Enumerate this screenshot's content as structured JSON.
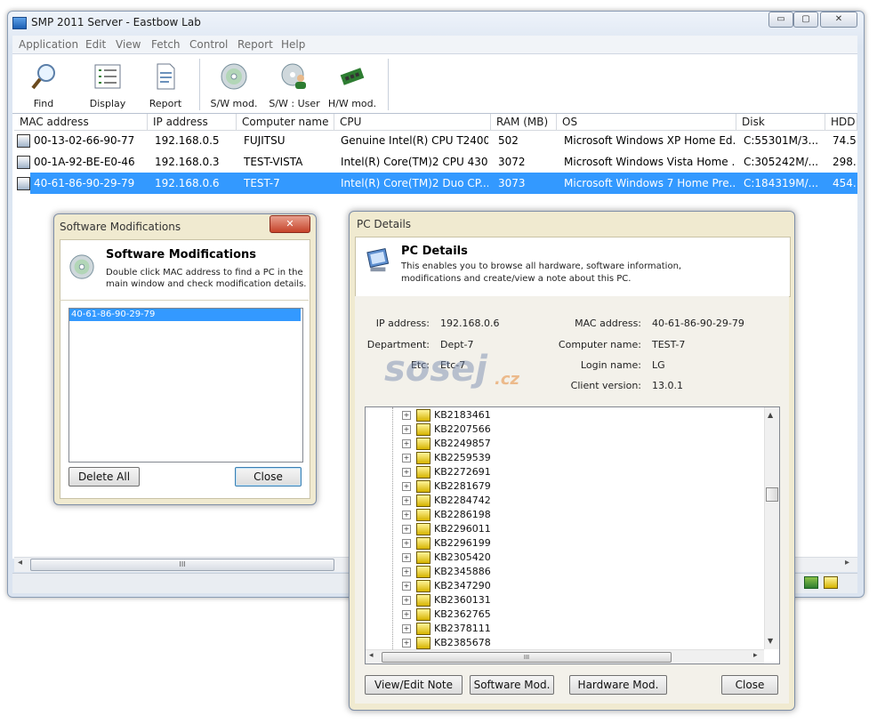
{
  "main_window": {
    "title": "SMP 2011 Server - Eastbow Lab",
    "caption_buttons": {
      "minimize": "▭",
      "maximize": "▢",
      "close": "✕"
    }
  },
  "menu": [
    "Application",
    "Edit",
    "View",
    "Fetch",
    "Control",
    "Report",
    "Help"
  ],
  "toolbar": [
    {
      "label": "Find",
      "icon": "magnifier-icon"
    },
    {
      "label": "Display",
      "icon": "list-icon"
    },
    {
      "label": "Report",
      "icon": "report-icon"
    },
    {
      "label": "S/W mod.",
      "icon": "cd-icon"
    },
    {
      "label": "S/W : User",
      "icon": "cd-user-icon"
    },
    {
      "label": "H/W mod.",
      "icon": "chip-icon"
    }
  ],
  "table": {
    "columns": [
      "MAC address",
      "IP address",
      "Computer name",
      "CPU",
      "RAM (MB)",
      "OS",
      "Disk",
      "HDD"
    ],
    "rows": [
      [
        "00-13-02-66-90-77",
        "192.168.0.5",
        "FUJITSU",
        "Genuine Intel(R) CPU T2400...",
        "502",
        "Microsoft Windows XP Home Ed...",
        "C:55301M/3...",
        "74.5"
      ],
      [
        "00-1A-92-BE-E0-46",
        "192.168.0.3",
        "TEST-VISTA",
        "Intel(R) Core(TM)2 CPU 430...",
        "3072",
        "Microsoft Windows Vista Home ...",
        "C:305242M/...",
        "298."
      ],
      [
        "40-61-86-90-29-79",
        "192.168.0.6",
        "TEST-7",
        "Intel(R) Core(TM)2 Duo CP...",
        "3073",
        "Microsoft Windows 7 Home Pre...",
        "C:184319M/...",
        "454."
      ]
    ],
    "selected_row": 2
  },
  "hscroll": {
    "grip": "III",
    "left": "◂",
    "right": "▸"
  },
  "sw_dialog": {
    "title": "Software Modifications",
    "close": "✕",
    "heading": "Software Modifications",
    "description_line1": "Double click MAC address to find a PC in the",
    "description_line2": "main window and check modification details.",
    "list_items": [
      "40-61-86-90-29-79"
    ],
    "delete_all": "Delete All",
    "close_button": "Close"
  },
  "pc_dialog": {
    "title": "PC Details",
    "heading": "PC Details",
    "description_line1": "This enables you to browse all hardware, software information,",
    "description_line2": "modifications and create/view a note about this PC.",
    "fields": {
      "ip_label": "IP address:",
      "ip_value": "192.168.0.6",
      "dept_label": "Department:",
      "dept_value": "Dept-7",
      "etc_label": "Etc:",
      "etc_value": "Etc-7",
      "mac_label": "MAC address:",
      "mac_value": "40-61-86-90-29-79",
      "name_label": "Computer name:",
      "name_value": "TEST-7",
      "login_label": "Login name:",
      "login_value": "LG",
      "client_label": "Client version:",
      "client_value": "13.0.1"
    },
    "tree_items": [
      "KB2183461",
      "KB2207566",
      "KB2249857",
      "KB2259539",
      "KB2272691",
      "KB2281679",
      "KB2284742",
      "KB2286198",
      "KB2296011",
      "KB2296199",
      "KB2305420",
      "KB2345886",
      "KB2347290",
      "KB2360131",
      "KB2362765",
      "KB2378111",
      "KB2385678"
    ],
    "buttons": {
      "note": "View/Edit Note",
      "sw": "Software Mod.",
      "hw": "Hardware Mod.",
      "close": "Close"
    },
    "hscroll_grip": "III"
  },
  "watermark": {
    "text": "sosej",
    "suffix": ".cz"
  },
  "colors": {
    "selection": "#3399ff",
    "dialog_bg": "#f0ead0",
    "window_frame": "#dbe4f0"
  }
}
